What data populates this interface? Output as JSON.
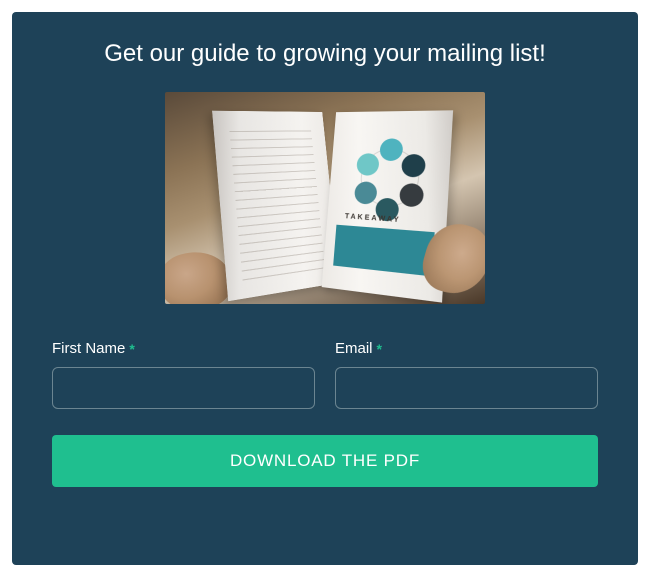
{
  "title": "Get our guide to growing your mailing list!",
  "image": {
    "alt": "open-magazine-with-circular-diagram"
  },
  "form": {
    "first_name": {
      "label": "First Name",
      "required_mark": "*",
      "value": ""
    },
    "email": {
      "label": "Email",
      "required_mark": "*",
      "value": ""
    }
  },
  "cta": {
    "label": "DOWNLOAD THE PDF"
  },
  "colors": {
    "panel_bg": "#1e4258",
    "accent": "#1fbf8f",
    "text": "#ffffff"
  }
}
